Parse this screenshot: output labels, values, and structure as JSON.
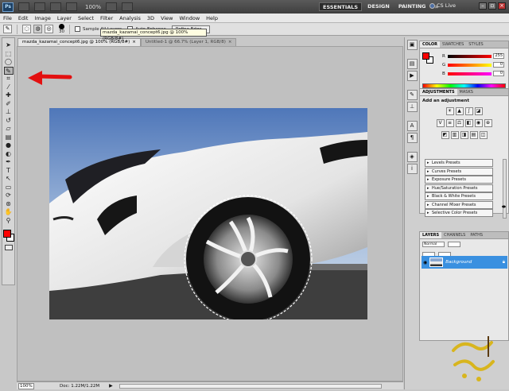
{
  "appbar": {
    "logo": "Ps",
    "zoom": "100%",
    "workspaces": [
      "ESSENTIALS",
      "DESIGN",
      "PAINTING"
    ],
    "more": "»",
    "cslive": "CS Live"
  },
  "menu": [
    "File",
    "Edit",
    "Image",
    "Layer",
    "Select",
    "Filter",
    "Analysis",
    "3D",
    "View",
    "Window",
    "Help"
  ],
  "options": {
    "brush_size": "30",
    "sample_all_layers": "Sample All Layers",
    "auto_enhance": "Auto-Enhance",
    "refine_edge": "Refine Edge..."
  },
  "document": {
    "tabs": [
      {
        "label": "mazda_kazamai_concept6.jpg @ 100% (RGB/8#)",
        "close": "×"
      },
      {
        "label": "Untitled-1 @ 66.7% (Layer 1, RGB/8)",
        "close": "×"
      }
    ],
    "tooltip": "mazda_kazamai_concept6.jpg @ 100% (RGB/8#)",
    "status_zoom": "100%",
    "doc_size": "Doc: 1.22M/1.22M"
  },
  "color_panel": {
    "tabs": [
      "COLOR",
      "SWATCHES",
      "STYLES"
    ],
    "sliders": [
      {
        "label": "R",
        "value": "255"
      },
      {
        "label": "G",
        "value": "0"
      },
      {
        "label": "B",
        "value": "0"
      }
    ]
  },
  "adjustments_panel": {
    "tabs": [
      "ADJUSTMENTS",
      "MASKS"
    ],
    "title": "Add an adjustment",
    "presets": [
      "Levels Presets",
      "Curves Presets",
      "Exposure Presets",
      "Hue/Saturation Presets",
      "Black & White Presets",
      "Channel Mixer Presets",
      "Selective Color Presets"
    ]
  },
  "layers_panel": {
    "tabs": [
      "LAYERS",
      "CHANNELS",
      "PATHS"
    ],
    "blend_mode": "Normal",
    "layer_name": "Background"
  },
  "colors": {
    "foreground": "#ff0000",
    "background": "#ffffff",
    "selected_layer": "#3a90e0",
    "arrow": "#e31010"
  }
}
